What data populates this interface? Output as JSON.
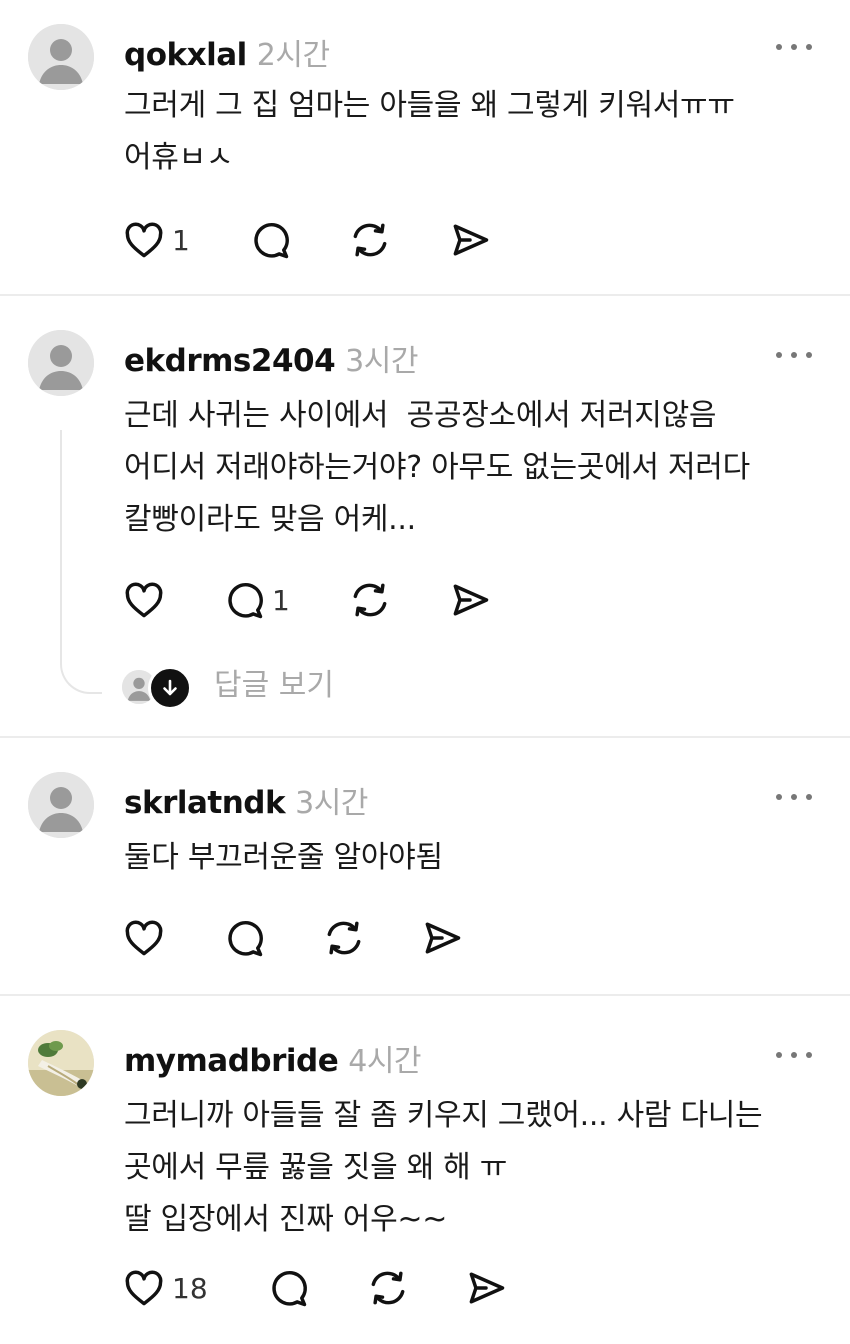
{
  "posts": [
    {
      "username": "qokxlal",
      "time": "2시간",
      "text": "그러게 그 집 엄마는 아들을 왜 그렇게 키워서ㅠㅠ\n어휴ㅂㅅ",
      "like_count": "1",
      "comment_count": "",
      "avatar": "default-avatar"
    },
    {
      "username": "ekdrms2404",
      "time": "3시간",
      "text": "근데 사귀는 사이에서  공공장소에서 저러지않음\n어디서 저래야하는거야? 아무도 없는곳에서 저러다\n칼빵이라도 맞음 어케...",
      "like_count": "",
      "comment_count": "1",
      "avatar": "default-avatar",
      "replies_label": "답글 보기"
    },
    {
      "username": "skrlatndk",
      "time": "3시간",
      "text": "둘다 부끄러운줄 알아야됨",
      "like_count": "",
      "comment_count": "",
      "avatar": "default-avatar"
    },
    {
      "username": "mymadbride",
      "time": "4시간",
      "text": "그러니까 아들들 잘 좀 키우지 그랬어... 사람 다니는\n곳에서 무릎 꿇을 짓을 왜 해 ㅠ\n딸 입장에서 진짜 어우~~",
      "like_count": "18",
      "comment_count": "",
      "avatar": "photo-avatar"
    }
  ],
  "icons": {
    "like": "heart-icon",
    "comment": "comment-bubble-icon",
    "repost": "repost-icon",
    "share": "send-icon",
    "more": "more-dots-icon",
    "expand_replies": "arrow-down-icon"
  },
  "colors": {
    "text": "#1a1a1a",
    "muted": "#a9a9a9",
    "divider": "#ececec",
    "avatar_bg": "#e4e4e4",
    "icon": "#111111"
  }
}
